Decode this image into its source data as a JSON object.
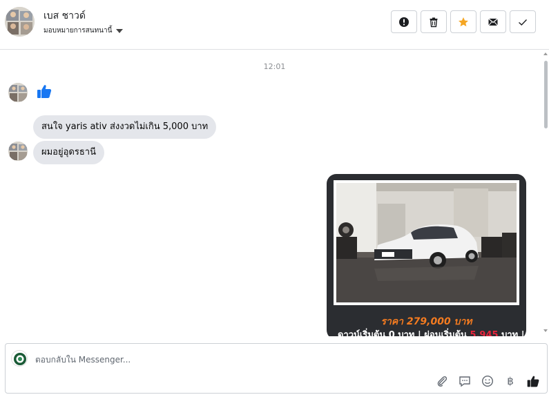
{
  "header": {
    "contact_name": "เบส ชาวด์",
    "assign_label": "มอบหมายการสนทนานี้",
    "actions": [
      {
        "name": "report-button",
        "icon": "exclamation-icon"
      },
      {
        "name": "delete-button",
        "icon": "trash-icon"
      },
      {
        "name": "star-button",
        "icon": "star-icon"
      },
      {
        "name": "mark-unread-button",
        "icon": "envelope-icon"
      },
      {
        "name": "mark-done-button",
        "icon": "check-icon"
      }
    ]
  },
  "conversation": {
    "timestamp": "12:01",
    "messages": [
      {
        "type": "like",
        "direction": "incoming"
      },
      {
        "type": "text",
        "direction": "incoming",
        "text": "สนใจ yaris ativ ส่งงวดไม่เกิน 5,000 บาท"
      },
      {
        "type": "text",
        "direction": "incoming",
        "text": "ผมอยู่อุดรธานี"
      }
    ],
    "card": {
      "price": "ราคา 279,000 บาท",
      "line2_a": "ดาวน์เริ่มต้น 0 บาท | ผ่อนเริ่มต้น ",
      "line2_highlight": "5,945",
      "line2_b": " บาท |"
    }
  },
  "composer": {
    "placeholder": "ตอบกลับใน Messenger...",
    "icons": [
      "attachment-icon",
      "saved-reply-icon",
      "emoji-icon",
      "payment-icon",
      "like-icon"
    ],
    "payment_glyph": "฿"
  },
  "colors": {
    "accent_blue": "#1877f2",
    "star_orange": "#f5a623",
    "price_orange": "#f47b20",
    "highlight_red": "#e8243c",
    "bubble_gray": "#e4e6eb"
  }
}
